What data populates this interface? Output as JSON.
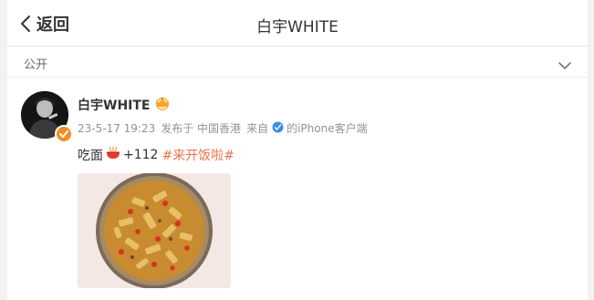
{
  "header": {
    "back_label": "返回",
    "title": "白宇WHITE"
  },
  "visibility": {
    "label": "公开"
  },
  "post": {
    "username": "白宇WHITE",
    "timestamp": "23-5-17 19:23",
    "location": "发布于 中国香港",
    "source_prefix": "来自",
    "source": "的iPhone客户端",
    "text": "吃面",
    "emoji_count": "+112",
    "hashtag": "#来开饭啦#"
  },
  "colors": {
    "hashtag": "#eb7350",
    "badge": "#f28c28",
    "meta": "#939393"
  }
}
